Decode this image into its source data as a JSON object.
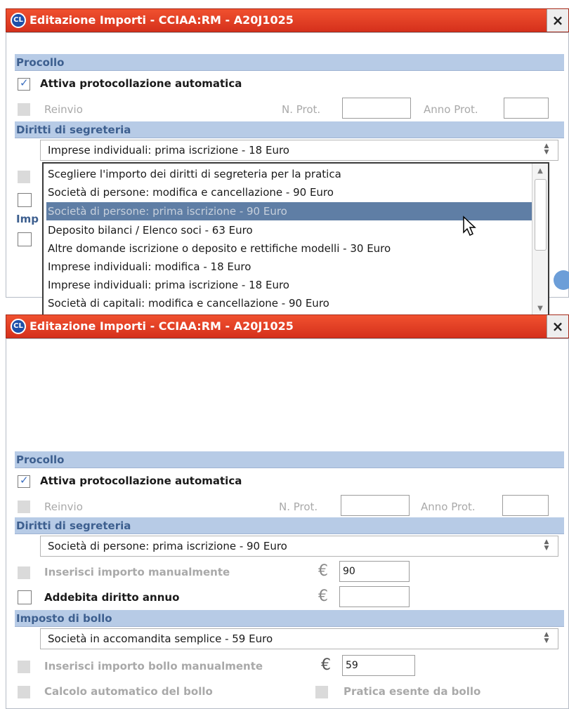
{
  "top_dialog": {
    "title": "Editazione Importi - CCIAA:RM - A20J1025",
    "logo_text": "CL",
    "close_label": "×",
    "procollo": {
      "header": "Procollo",
      "attiva_label": "Attiva protocollazione automatica",
      "attiva_checked": true,
      "reinvio_label": "Reinvio",
      "nprot_label": "N. Prot.",
      "nprot_value": "",
      "annoprot_label": "Anno Prot.",
      "annoprot_value": ""
    },
    "diritti": {
      "header": "Diritti di segreteria",
      "selected": "Imprese individuali: prima iscrizione - 18 Euro"
    },
    "partially_hidden_header": "Imp",
    "dropdown_options": [
      "Scegliere l'importo dei diritti di segreteria per la pratica",
      "Società di persone: modifica e cancellazione - 90 Euro",
      "Società di persone: prima iscrizione - 90 Euro",
      "Deposito bilanci / Elenco soci - 63 Euro",
      "Altre domande iscrizione o deposito e rettifiche modelli - 30 Euro",
      "Imprese individuali: modifica - 18 Euro",
      "Imprese individuali: prima iscrizione - 18 Euro",
      "Società di capitali: modifica e cancellazione - 90 Euro"
    ],
    "highlighted_option_index": 2
  },
  "bottom_dialog": {
    "title": "Editazione Importi - CCIAA:RM - A20J1025",
    "logo_text": "CL",
    "close_label": "×",
    "procollo": {
      "header": "Procollo",
      "attiva_label": "Attiva protocollazione automatica",
      "attiva_checked": true,
      "reinvio_label": "Reinvio",
      "nprot_label": "N. Prot.",
      "nprot_value": "",
      "annoprot_label": "Anno Prot.",
      "annoprot_value": ""
    },
    "diritti": {
      "header": "Diritti di segreteria",
      "selected": "Società di persone: prima iscrizione - 90 Euro",
      "manual_label": "Inserisci importo manualmente",
      "euro_symbol": "€",
      "manual_value": "90",
      "annuo_label": "Addebita diritto annuo",
      "annuo_value": ""
    },
    "bollo": {
      "header": "Imposto di bollo",
      "selected": "Società in accomandita semplice - 59 Euro",
      "manual_label": "Inserisci importo bollo manualmente",
      "euro_symbol": "€",
      "manual_value": "59",
      "auto_label": "Calcolo automatico del bollo",
      "esente_label": "Pratica esente da bollo"
    }
  },
  "colors": {
    "titlebar": "#d5301c",
    "section_header_bg": "#b7cbe6",
    "section_header_text": "#3d5f8f",
    "highlight": "#5f7ea5"
  }
}
